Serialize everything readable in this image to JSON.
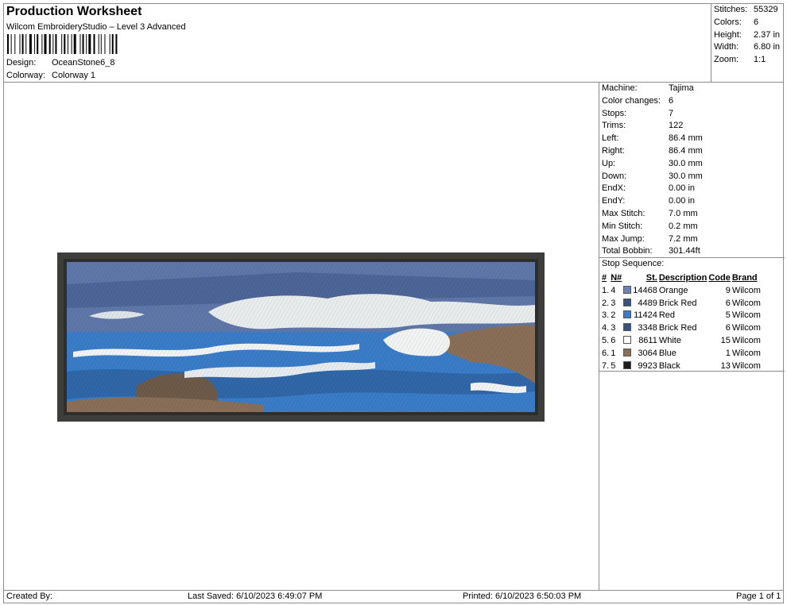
{
  "header": {
    "title": "Production Worksheet",
    "software": "Wilcom EmbroideryStudio – Level 3 Advanced",
    "design_label": "Design:",
    "design_value": "OceanStone6_8",
    "colorway_label": "Colorway:",
    "colorway_value": "Colorway 1"
  },
  "summary": {
    "stitches_label": "Stitches:",
    "stitches_value": "55329",
    "colors_label": "Colors:",
    "colors_value": "6",
    "height_label": "Height:",
    "height_value": "2.37 in",
    "width_label": "Width:",
    "width_value": "6.80 in",
    "zoom_label": "Zoom:",
    "zoom_value": "1:1"
  },
  "machine_info": [
    {
      "label": "Machine:",
      "value": "Tajima"
    },
    {
      "label": "Color changes:",
      "value": "6"
    },
    {
      "label": "Stops:",
      "value": "7"
    },
    {
      "label": "Trims:",
      "value": "122"
    },
    {
      "label": "Left:",
      "value": "86.4 mm"
    },
    {
      "label": "Right:",
      "value": "86.4 mm"
    },
    {
      "label": "Up:",
      "value": "30.0 mm"
    },
    {
      "label": "Down:",
      "value": "30.0 mm"
    },
    {
      "label": "EndX:",
      "value": "0.00 in"
    },
    {
      "label": "EndY:",
      "value": "0.00 in"
    },
    {
      "label": "Max Stitch:",
      "value": "7.0 mm"
    },
    {
      "label": "Min Stitch:",
      "value": "0.2 mm"
    },
    {
      "label": "Max Jump:",
      "value": "7.2 mm"
    },
    {
      "label": "Total Bobbin:",
      "value": "301.44ft"
    }
  ],
  "stop_sequence": {
    "title": "Stop Sequence:",
    "headers": {
      "num": "#",
      "n": "N#",
      "st": "St.",
      "description": "Description",
      "code": "Code",
      "brand": "Brand"
    },
    "rows": [
      {
        "num": "1.",
        "n": "4",
        "color": "#6b84b5",
        "st": "14468",
        "description": "Orange",
        "code": "9",
        "brand": "Wilcom"
      },
      {
        "num": "2.",
        "n": "3",
        "color": "#3a5184",
        "st": "4489",
        "description": "Brick Red",
        "code": "6",
        "brand": "Wilcom"
      },
      {
        "num": "3.",
        "n": "2",
        "color": "#3a7cc7",
        "st": "11424",
        "description": "Red",
        "code": "5",
        "brand": "Wilcom"
      },
      {
        "num": "4.",
        "n": "3",
        "color": "#3a5184",
        "st": "3348",
        "description": "Brick Red",
        "code": "6",
        "brand": "Wilcom"
      },
      {
        "num": "5.",
        "n": "6",
        "color": "#ffffff",
        "st": "8611",
        "description": "White",
        "code": "15",
        "brand": "Wilcom"
      },
      {
        "num": "6.",
        "n": "1",
        "color": "#8a6f58",
        "st": "3064",
        "description": "Blue",
        "code": "1",
        "brand": "Wilcom"
      },
      {
        "num": "7.",
        "n": "5",
        "color": "#1c1c1c",
        "st": "9923",
        "description": "Black",
        "code": "13",
        "brand": "Wilcom"
      }
    ]
  },
  "footer": {
    "created_by": "Created By:",
    "last_saved": "Last Saved: 6/10/2023 6:49:07 PM",
    "printed": "Printed: 6/10/2023 6:50:03 PM",
    "page": "Page 1 of 1"
  },
  "design_preview": {
    "border_color": "#3d3d3b",
    "sky_color": "#5f77a8",
    "cloud_color": "#e9ecec",
    "sea_color": "#3a7cc7",
    "foam_color": "#f2f4f4",
    "rock_color": "#8a6f58"
  }
}
